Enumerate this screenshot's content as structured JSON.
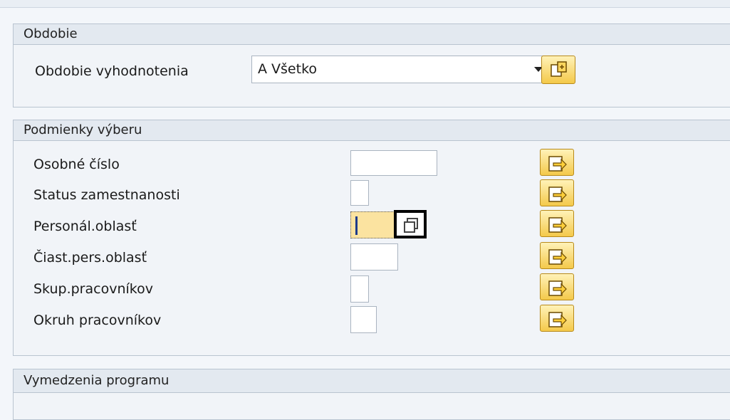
{
  "groups": {
    "obdobie": {
      "title": "Obdobie",
      "period_label": "Obdobie vyhodnotenia",
      "period_value": "A Všetko"
    },
    "podmienky": {
      "title": "Podmienky výberu",
      "fields": [
        {
          "label": "Osobné číslo",
          "value": ""
        },
        {
          "label": "Status zamestnanosti",
          "value": ""
        },
        {
          "label": "Personál.oblasť",
          "value": ""
        },
        {
          "label": "Čiast.pers.oblasť",
          "value": ""
        },
        {
          "label": "Skup.pracovníkov",
          "value": ""
        },
        {
          "label": "Okruh pracovníkov",
          "value": ""
        }
      ]
    },
    "vymedzenia": {
      "title": "Vymedzenia programu"
    }
  },
  "icons": {
    "multiple_selection": "multiple-selection-arrow-icon",
    "value_help": "value-help-icon",
    "dropdown": "chevron-down-icon"
  },
  "colors": {
    "button_yellow": "#f4c94a",
    "active_field": "#fbe3a0",
    "group_header": "#e3e9f0"
  }
}
